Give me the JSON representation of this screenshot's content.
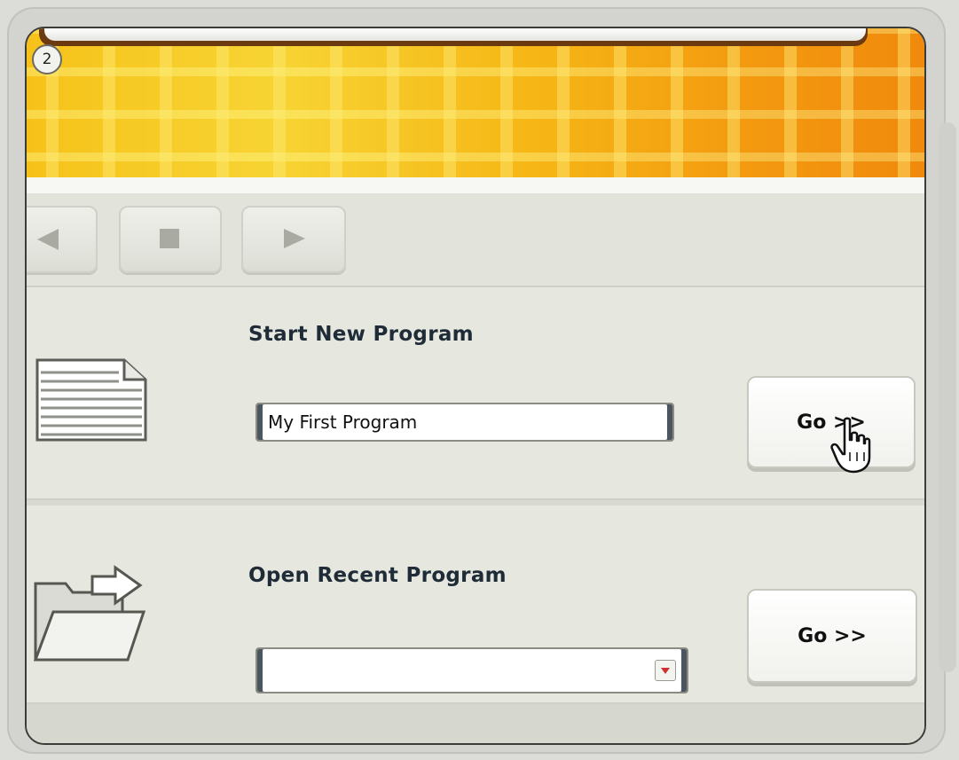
{
  "step_badge": "2",
  "nav": {
    "back_icon": "triangle-left-icon",
    "stop_icon": "square-stop-icon",
    "forward_icon": "triangle-right-icon"
  },
  "start_new": {
    "title": "Start New Program",
    "input_value": "My First Program",
    "go_label": "Go >>",
    "icon": "document-icon"
  },
  "open_recent": {
    "title": "Open Recent Program",
    "selected_value": "",
    "go_label": "Go >>",
    "icon": "folder-open-icon"
  },
  "colors": {
    "banner_start": "#f6c21a",
    "banner_end": "#f08a0c",
    "title_text": "#1f2c38",
    "dropdown_arrow": "#d12f2f"
  }
}
